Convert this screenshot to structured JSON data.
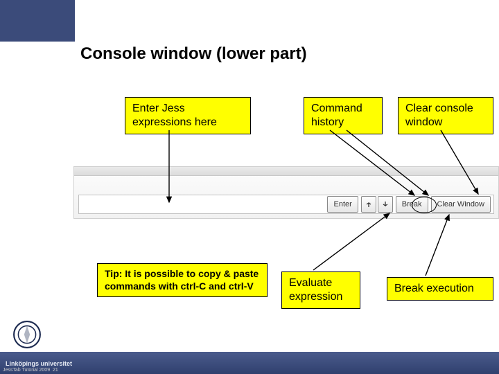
{
  "slide": {
    "title": "Console window (lower part)",
    "footer_source": "JessTab Tutorial 2009",
    "footer_page": "21",
    "university": "Linköpings universitet"
  },
  "callouts": {
    "enter_expr": "Enter Jess expressions here",
    "cmd_history": "Command history",
    "clear_console": "Clear console window",
    "tip": "Tip: It is possible to copy & paste commands with ctrl-C and ctrl-V",
    "evaluate": "Evaluate expression",
    "break_exec": "Break execution"
  },
  "console": {
    "buttons": {
      "enter": "Enter",
      "history_prev": "prev",
      "history_next": "next",
      "break": "Break",
      "clear": "Clear Window"
    }
  }
}
